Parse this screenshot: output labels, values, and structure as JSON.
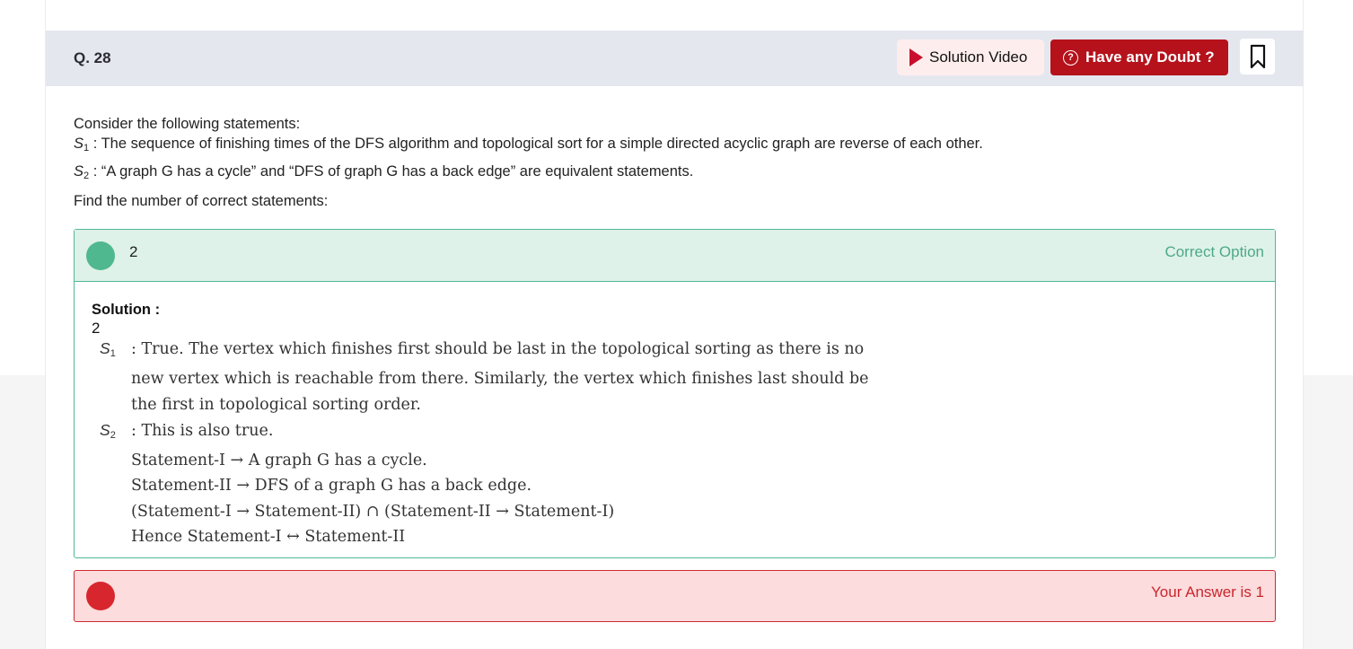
{
  "question": {
    "number": "Q. 28",
    "intro": "Consider the following statements:",
    "s1_label": "S",
    "s1_sub": "1",
    "s1_text": " : The sequence of finishing times of the DFS algorithm and topological sort for a simple directed acyclic graph are reverse of each other.",
    "s2_label": "S",
    "s2_sub": "2",
    "s2_text": " : “A graph G has a cycle” and “DFS of graph G has a back edge” are equivalent statements.",
    "prompt": "Find the number of correct statements:"
  },
  "header": {
    "solution_video_label": "Solution Video",
    "doubt_label": "Have any Doubt ?"
  },
  "correct_option": {
    "text": "2",
    "label": "Correct Option"
  },
  "solution": {
    "title": "Solution :",
    "value": "2",
    "s1_label": "S",
    "s1_sub": "1",
    "s1_lines": [
      ": True. The vertex which finishes first should be last in the topological sorting as there is no",
      "new vertex which is reachable from there. Similarly, the vertex which finishes last should be",
      "the first in topological sorting order."
    ],
    "s2_label": "S",
    "s2_sub": "2",
    "s2_lines": [
      ": This is also true.",
      "Statement-I → A graph G has a cycle.",
      "Statement-II → DFS of a graph G has a back edge.",
      "(Statement-I → Statement-II) ∩ (Statement-II → Statement-I)",
      "Hence Statement-I ↔ Statement-II"
    ]
  },
  "your_answer": {
    "label": "Your Answer is 1"
  },
  "colors": {
    "accent_red": "#b5121b",
    "correct_green": "#4fb88f",
    "wrong_red": "#d7262e"
  }
}
